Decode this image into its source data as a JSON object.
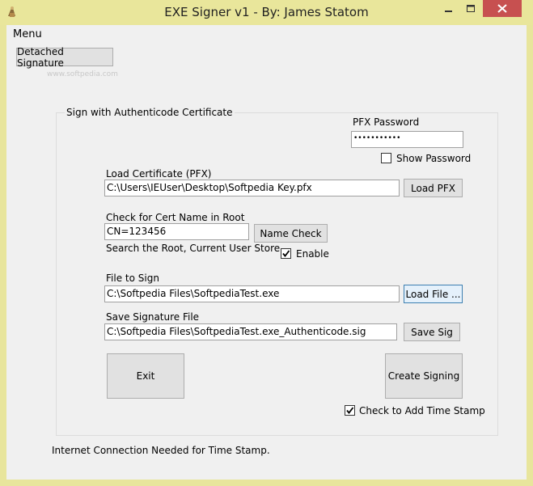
{
  "window": {
    "title": "EXE Signer v1 - By: James Statom"
  },
  "menu": {
    "label": "Menu"
  },
  "toolbar": {
    "detached_signature_label": "Detached Signature"
  },
  "watermark": {
    "text": "www.softpedia.com"
  },
  "group": {
    "title": "Sign with Authenticode Certificate",
    "pfx_password_label": "PFX Password",
    "pfx_password_value": "•••••••••••",
    "show_password_label": "Show Password",
    "show_password_checked": false,
    "load_cert_label": "Load Certificate (PFX)",
    "load_cert_value": "C:\\Users\\IEUser\\Desktop\\Softpedia Key.pfx",
    "load_pfx_button": "Load PFX",
    "cert_name_label": "Check for Cert Name in Root",
    "cert_name_value": "CN=123456",
    "name_check_button": "Name Check",
    "search_root_text": "Search the Root, Current User Store",
    "enable_label": "Enable",
    "enable_checked": true,
    "file_to_sign_label": "File to Sign",
    "file_to_sign_value": "C:\\Softpedia Files\\SoftpediaTest.exe",
    "load_file_button": "Load File ...",
    "save_sig_label": "Save Signature File",
    "save_sig_value": "C:\\Softpedia Files\\SoftpediaTest.exe_Authenticode.sig",
    "save_sig_button": "Save Sig",
    "exit_button": "Exit",
    "create_signing_button": "Create Signing",
    "timestamp_label": "Check to Add Time Stamp",
    "timestamp_checked": true
  },
  "status": {
    "internet_note": "Internet Connection Needed for Time Stamp."
  },
  "colors": {
    "title_bar": "#e9e69b",
    "close_button": "#c75050",
    "client_background": "#f0f0f0"
  }
}
